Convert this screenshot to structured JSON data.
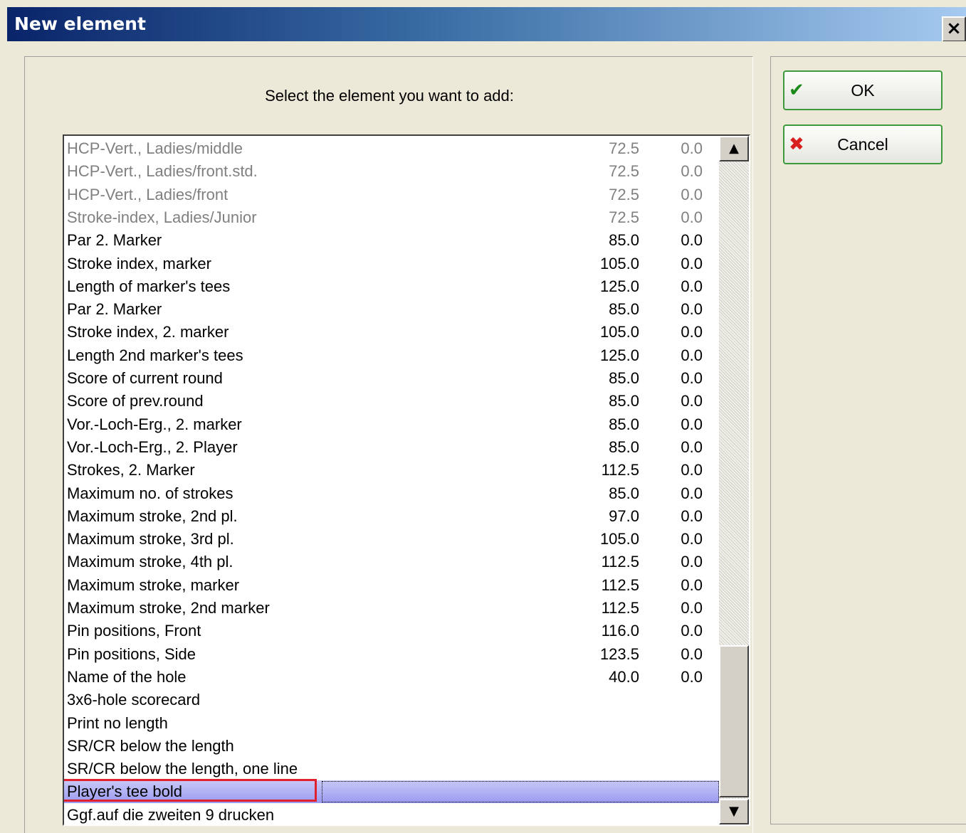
{
  "window": {
    "title": "New element",
    "close_glyph": "×"
  },
  "prompt": "Select the element you want to add:",
  "list": {
    "items": [
      {
        "name": "HCP-Vert., Ladies/middle",
        "v1": "72.5",
        "v2": "0.0",
        "disabled": true
      },
      {
        "name": "HCP-Vert., Ladies/front.std.",
        "v1": "72.5",
        "v2": "0.0",
        "disabled": true
      },
      {
        "name": "HCP-Vert., Ladies/front",
        "v1": "72.5",
        "v2": "0.0",
        "disabled": true
      },
      {
        "name": "Stroke-index, Ladies/Junior",
        "v1": "72.5",
        "v2": "0.0",
        "disabled": true
      },
      {
        "name": "Par 2. Marker",
        "v1": "85.0",
        "v2": "0.0"
      },
      {
        "name": "Stroke index, marker",
        "v1": "105.0",
        "v2": "0.0"
      },
      {
        "name": "Length of marker's tees",
        "v1": "125.0",
        "v2": "0.0"
      },
      {
        "name": "Par 2. Marker",
        "v1": "85.0",
        "v2": "0.0"
      },
      {
        "name": "Stroke index, 2. marker",
        "v1": "105.0",
        "v2": "0.0"
      },
      {
        "name": "Length 2nd marker's tees",
        "v1": "125.0",
        "v2": "0.0"
      },
      {
        "name": "Score of current round",
        "v1": "85.0",
        "v2": "0.0"
      },
      {
        "name": "Score of prev.round",
        "v1": "85.0",
        "v2": "0.0"
      },
      {
        "name": "Vor.-Loch-Erg., 2. marker",
        "v1": "85.0",
        "v2": "0.0"
      },
      {
        "name": "Vor.-Loch-Erg., 2. Player",
        "v1": "85.0",
        "v2": "0.0"
      },
      {
        "name": "Strokes, 2. Marker",
        "v1": "112.5",
        "v2": "0.0"
      },
      {
        "name": "Maximum no. of strokes",
        "v1": "85.0",
        "v2": "0.0"
      },
      {
        "name": "Maximum stroke, 2nd pl.",
        "v1": "97.0",
        "v2": "0.0"
      },
      {
        "name": "Maximum stroke, 3rd pl.",
        "v1": "105.0",
        "v2": "0.0"
      },
      {
        "name": "Maximum stroke, 4th pl.",
        "v1": "112.5",
        "v2": "0.0"
      },
      {
        "name": "Maximum stroke, marker",
        "v1": "112.5",
        "v2": "0.0"
      },
      {
        "name": "Maximum stroke, 2nd marker",
        "v1": "112.5",
        "v2": "0.0"
      },
      {
        "name": "Pin positions, Front",
        "v1": "116.0",
        "v2": "0.0"
      },
      {
        "name": "Pin positions, Side",
        "v1": "123.5",
        "v2": "0.0"
      },
      {
        "name": "Name of the hole",
        "v1": "40.0",
        "v2": "0.0"
      },
      {
        "name": "3x6-hole scorecard",
        "v1": "",
        "v2": ""
      },
      {
        "name": "Print no length",
        "v1": "",
        "v2": ""
      },
      {
        "name": "SR/CR below the length",
        "v1": "",
        "v2": ""
      },
      {
        "name": "SR/CR below the length, one line",
        "v1": "",
        "v2": ""
      },
      {
        "name": "Player's tee bold",
        "v1": "",
        "v2": "",
        "selected": true
      },
      {
        "name": "Ggf.auf die zweiten 9 drucken",
        "v1": "",
        "v2": ""
      }
    ]
  },
  "scrollbar": {
    "up_glyph": "▲",
    "down_glyph": "▼"
  },
  "buttons": {
    "ok": {
      "label": "OK",
      "icon": "checkmark-icon",
      "glyph": "✔"
    },
    "cancel": {
      "label": "Cancel",
      "icon": "x-icon",
      "glyph": "✖"
    }
  }
}
